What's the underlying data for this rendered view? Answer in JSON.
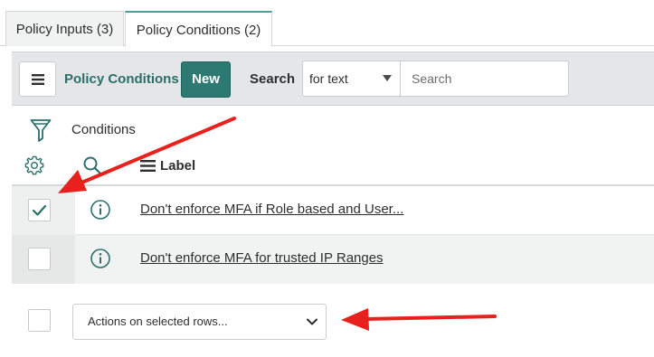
{
  "tabs": [
    {
      "label": "Policy Inputs (3)",
      "active": false
    },
    {
      "label": "Policy Conditions (2)",
      "active": true
    }
  ],
  "toolbar": {
    "title": "Policy Conditions",
    "new_label": "New",
    "search_label": "Search",
    "search_field_value": "for text",
    "search_placeholder": "Search"
  },
  "filter": {
    "conditions_label": "Conditions"
  },
  "list": {
    "column_header": "Label",
    "rows": [
      {
        "label": "Don't enforce MFA if Role based and User...",
        "checked": true
      },
      {
        "label": "Don't enforce MFA for trusted IP Ranges",
        "checked": false
      }
    ]
  },
  "actions": {
    "label": "Actions on selected rows..."
  },
  "colors": {
    "accent": "#2d7a72",
    "annotation_arrow": "#e8211d"
  },
  "icons": [
    "hamburger-icon",
    "filter-icon",
    "gear-icon",
    "search-icon",
    "list-icon",
    "info-icon",
    "check-icon",
    "chevron-down-icon",
    "caret-down-icon"
  ]
}
